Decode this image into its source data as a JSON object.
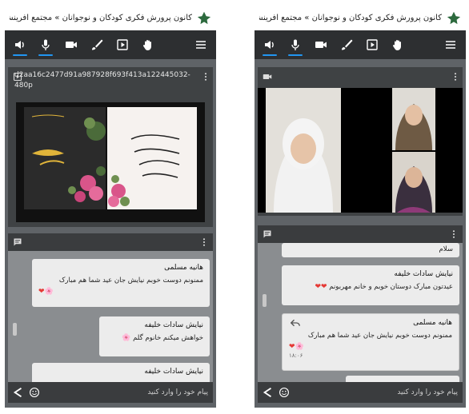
{
  "app": {
    "title_left": "کانون پرورش فکری کودکان و نوجوانان » مجتمع آفرینش های فر",
    "title_right": "کانون پرورش فکری کودکان و نوجوانان » مجتمع آفرینش های فرهنگی",
    "accent_color": "#2196f3",
    "toolbar_icons": [
      "speaker-icon",
      "microphone-icon",
      "camera-icon",
      "brush-icon",
      "play-box-icon",
      "raise-hand-icon",
      "menu-icon"
    ]
  },
  "left": {
    "video_filename": "d2aa16c2477d91a987928f693f413a122445032-480p",
    "chat": {
      "messages": [
        {
          "name": "هانیه مسلمی",
          "text": "ممنونم دوست خوبم نیایش جان   عید شما هم   مبارک",
          "emoji": "🌸❤"
        },
        {
          "name": "نیایش سادات خلیفه",
          "text": "خواهش میکنم خانوم گلم",
          "emoji": "🌸"
        },
        {
          "name": "نیایش سادات خلیفه",
          "text": "",
          "emoji": ""
        }
      ],
      "input_placeholder": "پیام خود را وارد کنید"
    }
  },
  "right": {
    "chat": {
      "messages": [
        {
          "name": "",
          "text": "سلام",
          "emoji": ""
        },
        {
          "name": "نیایش سادات خلیفه",
          "text": "عیدتون مبارک دوستان خوبم و خانم مهربونم",
          "emoji": "❤❤"
        },
        {
          "name": "هانیه مسلمی",
          "text": "ممنونم دوست خوبم نیایش جان   عید شما هم   مبارک",
          "emoji": "🌸❤",
          "time": "۱۸:۰۶"
        }
      ],
      "input_placeholder": "پیام خود را وارد کنید"
    }
  }
}
